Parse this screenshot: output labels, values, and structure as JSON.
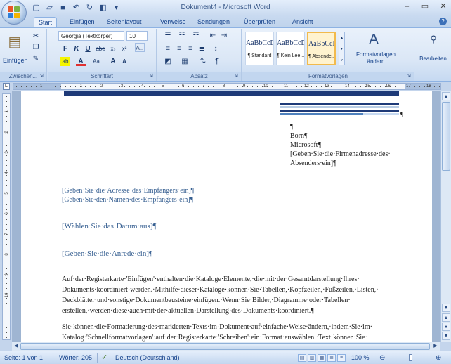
{
  "window": {
    "title": "Dokument4 - Microsoft Word",
    "qat_icons": [
      "save-icon",
      "undo-icon",
      "redo-icon",
      "print-preview-icon",
      "customize-icon"
    ],
    "controls": {
      "minimize": "‒",
      "maximize": "▭",
      "close": "✕"
    }
  },
  "tabs": [
    "Start",
    "Einfügen",
    "Seitenlayout",
    "Verweise",
    "Sendungen",
    "Überprüfen",
    "Ansicht"
  ],
  "active_tab": "Start",
  "ribbon": {
    "clipboard": {
      "paste_label": "Einfügen",
      "group_label": "Zwischen..."
    },
    "font": {
      "font_name": "Georgia (Textkörper)",
      "font_size": "10",
      "bold": "F",
      "italic": "K",
      "underline": "U",
      "strike": "abe",
      "subscript": "x₂",
      "superscript": "x²",
      "highlight": "ab",
      "font_color": "A",
      "case": "Aa",
      "grow": "A",
      "shrink": "A",
      "group_label": "Schriftart"
    },
    "paragraph": {
      "group_label": "Absatz"
    },
    "styles": {
      "items": [
        {
          "sample": "AaBbCcD",
          "name": "¶ Standard",
          "selected": false
        },
        {
          "sample": "AaBbCcD",
          "name": "¶ Kein Lee...",
          "selected": false
        },
        {
          "sample": "AaBbCcD",
          "name": "¶ Absende...",
          "selected": true
        }
      ],
      "change_styles_label": "Formatvorlagen ändern",
      "group_label": "Formatvorlagen"
    },
    "edit": {
      "label": "Bearbeiten"
    }
  },
  "ruler": {
    "numbers": [
      "1",
      "1",
      "2",
      "3",
      "4",
      "5",
      "6",
      "7",
      "8",
      "9",
      "10",
      "11",
      "12",
      "13",
      "14",
      "15",
      "16",
      "17",
      "18"
    ],
    "vertical_numbers": [
      "1",
      "2",
      "3",
      "4",
      "5",
      "6",
      "7",
      "8",
      "9",
      "10"
    ]
  },
  "document": {
    "pilcrow_top": "¶",
    "sender": [
      "¶",
      "Born¶",
      "Microsoft¶",
      "[Geben·Sie·die·Firmenadresse·des·",
      "Absenders·ein]¶"
    ],
    "recipient": [
      "[Geben·Sie·die·Adresse·des·Empfängers·ein]¶",
      "[Geben·Sie·den·Namen·des·Empfängers·ein]¶"
    ],
    "date": "[Wählen·Sie·das·Datum·aus]¶",
    "salutation": "[Geben·Sie·die·Anrede·ein]¶",
    "body1": [
      "Auf·der·Registerkarte·'Einfügen'·enthalten·die·Kataloge·Elemente,·die·mit·der·Gesamtdarstellung·Ihres·",
      "Dokuments·koordiniert·werden.·Mithilfe·dieser·Kataloge·können·Sie·Tabellen,·Kopfzeilen,·Fußzeilen,·Listen,·",
      "Deckblätter·und·sonstige·Dokumentbausteine·einfügen.·Wenn·Sie·Bilder,·Diagramme·oder·Tabellen·",
      "erstellen,·werden·diese·auch·mit·der·aktuellen·Darstellung·des·Dokuments·koordiniert.¶"
    ],
    "body2": [
      "Sie·können·die·Formatierung·des·markierten·Texts·im·Dokument·auf·einfache·Weise·ändern,·indem·Sie·im·",
      "Katalog·'Schnellformatvorlagen'·auf·der·Registerkarte·'Schreiben'·ein·Format·auswählen.·Text·können·Sie·"
    ]
  },
  "status": {
    "page": "Seite: 1 von 1",
    "words": "Wörter: 205",
    "language": "Deutsch (Deutschland)",
    "zoom": "100 %"
  },
  "colors": {
    "accent": "#1e3a78",
    "placeholder_text": "#365f91"
  }
}
